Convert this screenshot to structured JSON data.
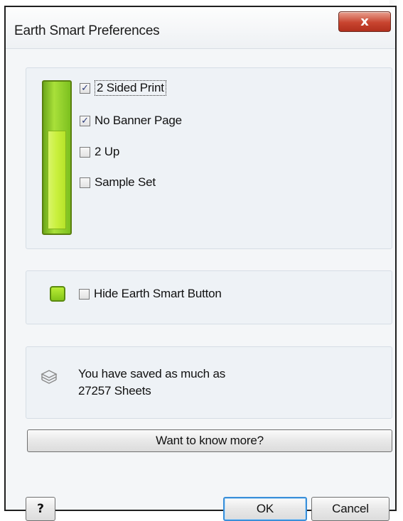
{
  "window": {
    "title": "Earth Smart Preferences",
    "close_glyph": "x"
  },
  "options": [
    {
      "label": "2 Sided Print",
      "checked": true
    },
    {
      "label": "No Banner Page",
      "checked": true
    },
    {
      "label": "2 Up",
      "checked": false
    },
    {
      "label": "Sample Set",
      "checked": false
    }
  ],
  "gauge": {
    "level": 0.68
  },
  "hide_button": {
    "label": "Hide Earth Smart Button",
    "checked": false
  },
  "savings": {
    "line1": "You have saved as much as",
    "line2": "27257 Sheets"
  },
  "buttons": {
    "more": "Want to know more?",
    "help": "?",
    "ok": "OK",
    "cancel": "Cancel"
  },
  "colors": {
    "accent_green": "#a9e03a",
    "close_red": "#c8442f",
    "ok_focus": "#3a8fd9"
  },
  "icons": [
    "close-icon",
    "gauge-icon",
    "earth-smart-button-icon",
    "sheets-stack-icon"
  ]
}
